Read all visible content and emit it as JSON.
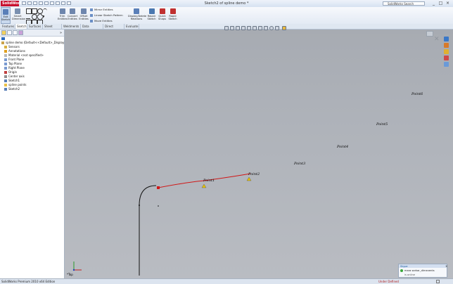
{
  "window": {
    "app_logo": "SolidWorks",
    "title": "Sketch2 of spline demo *",
    "search_placeholder": "SolidWorks Search",
    "controls": [
      "_",
      "□",
      "×"
    ]
  },
  "ribbon": {
    "buttons": [
      "Exit Sketch",
      "Smart Dimension",
      "Trim Entities",
      "Convert Entities",
      "Offset Entities",
      "Display/Delete Relations",
      "Repair Sketch",
      "Quick Snaps",
      "Rapid Sketch"
    ],
    "small_items": [
      "Mirror Entities",
      "Linear Sketch Pattern",
      "Move Entities"
    ]
  },
  "command_tabs": [
    "Features",
    "Sketch",
    "Surfaces",
    "Sheet Metal",
    "Weldments",
    "Data Migration",
    "Direct Editing",
    "Evaluate"
  ],
  "active_tab": "Sketch",
  "feature_tree": [
    {
      "label": "spline demo  (Default<<Default>_Display Stat",
      "icon": "part-icon"
    },
    {
      "label": "Sensors",
      "icon": "sensor-icon"
    },
    {
      "label": "Annotations",
      "icon": "annotation-icon"
    },
    {
      "label": "Material <not specified>",
      "icon": "material-icon"
    },
    {
      "label": "Front Plane",
      "icon": "plane-icon"
    },
    {
      "label": "Top Plane",
      "icon": "plane-icon"
    },
    {
      "label": "Right Plane",
      "icon": "plane-icon"
    },
    {
      "label": "Origin",
      "icon": "origin-icon"
    },
    {
      "label": "Center axis",
      "icon": "axis-icon"
    },
    {
      "label": "Sketch1",
      "icon": "sketch-icon"
    },
    {
      "label": "spline points",
      "icon": "folder-icon"
    },
    {
      "label": "Sketch2",
      "icon": "sketch-icon"
    }
  ],
  "sketch": {
    "points": [
      "Point1",
      "Point2",
      "Point3",
      "Point4",
      "Point5",
      "Point6"
    ],
    "orientation_label": "*Top"
  },
  "status": {
    "left": "SolidWorks Premium 2010 x64 Edition",
    "right": "Under Defined"
  },
  "chat": {
    "title": "Skype",
    "name": "mara sarkar_dlrnevents",
    "status": "is online"
  },
  "colors": {
    "spline": "#d01818",
    "brand": "#c8102e",
    "point_label": "#23308e"
  }
}
